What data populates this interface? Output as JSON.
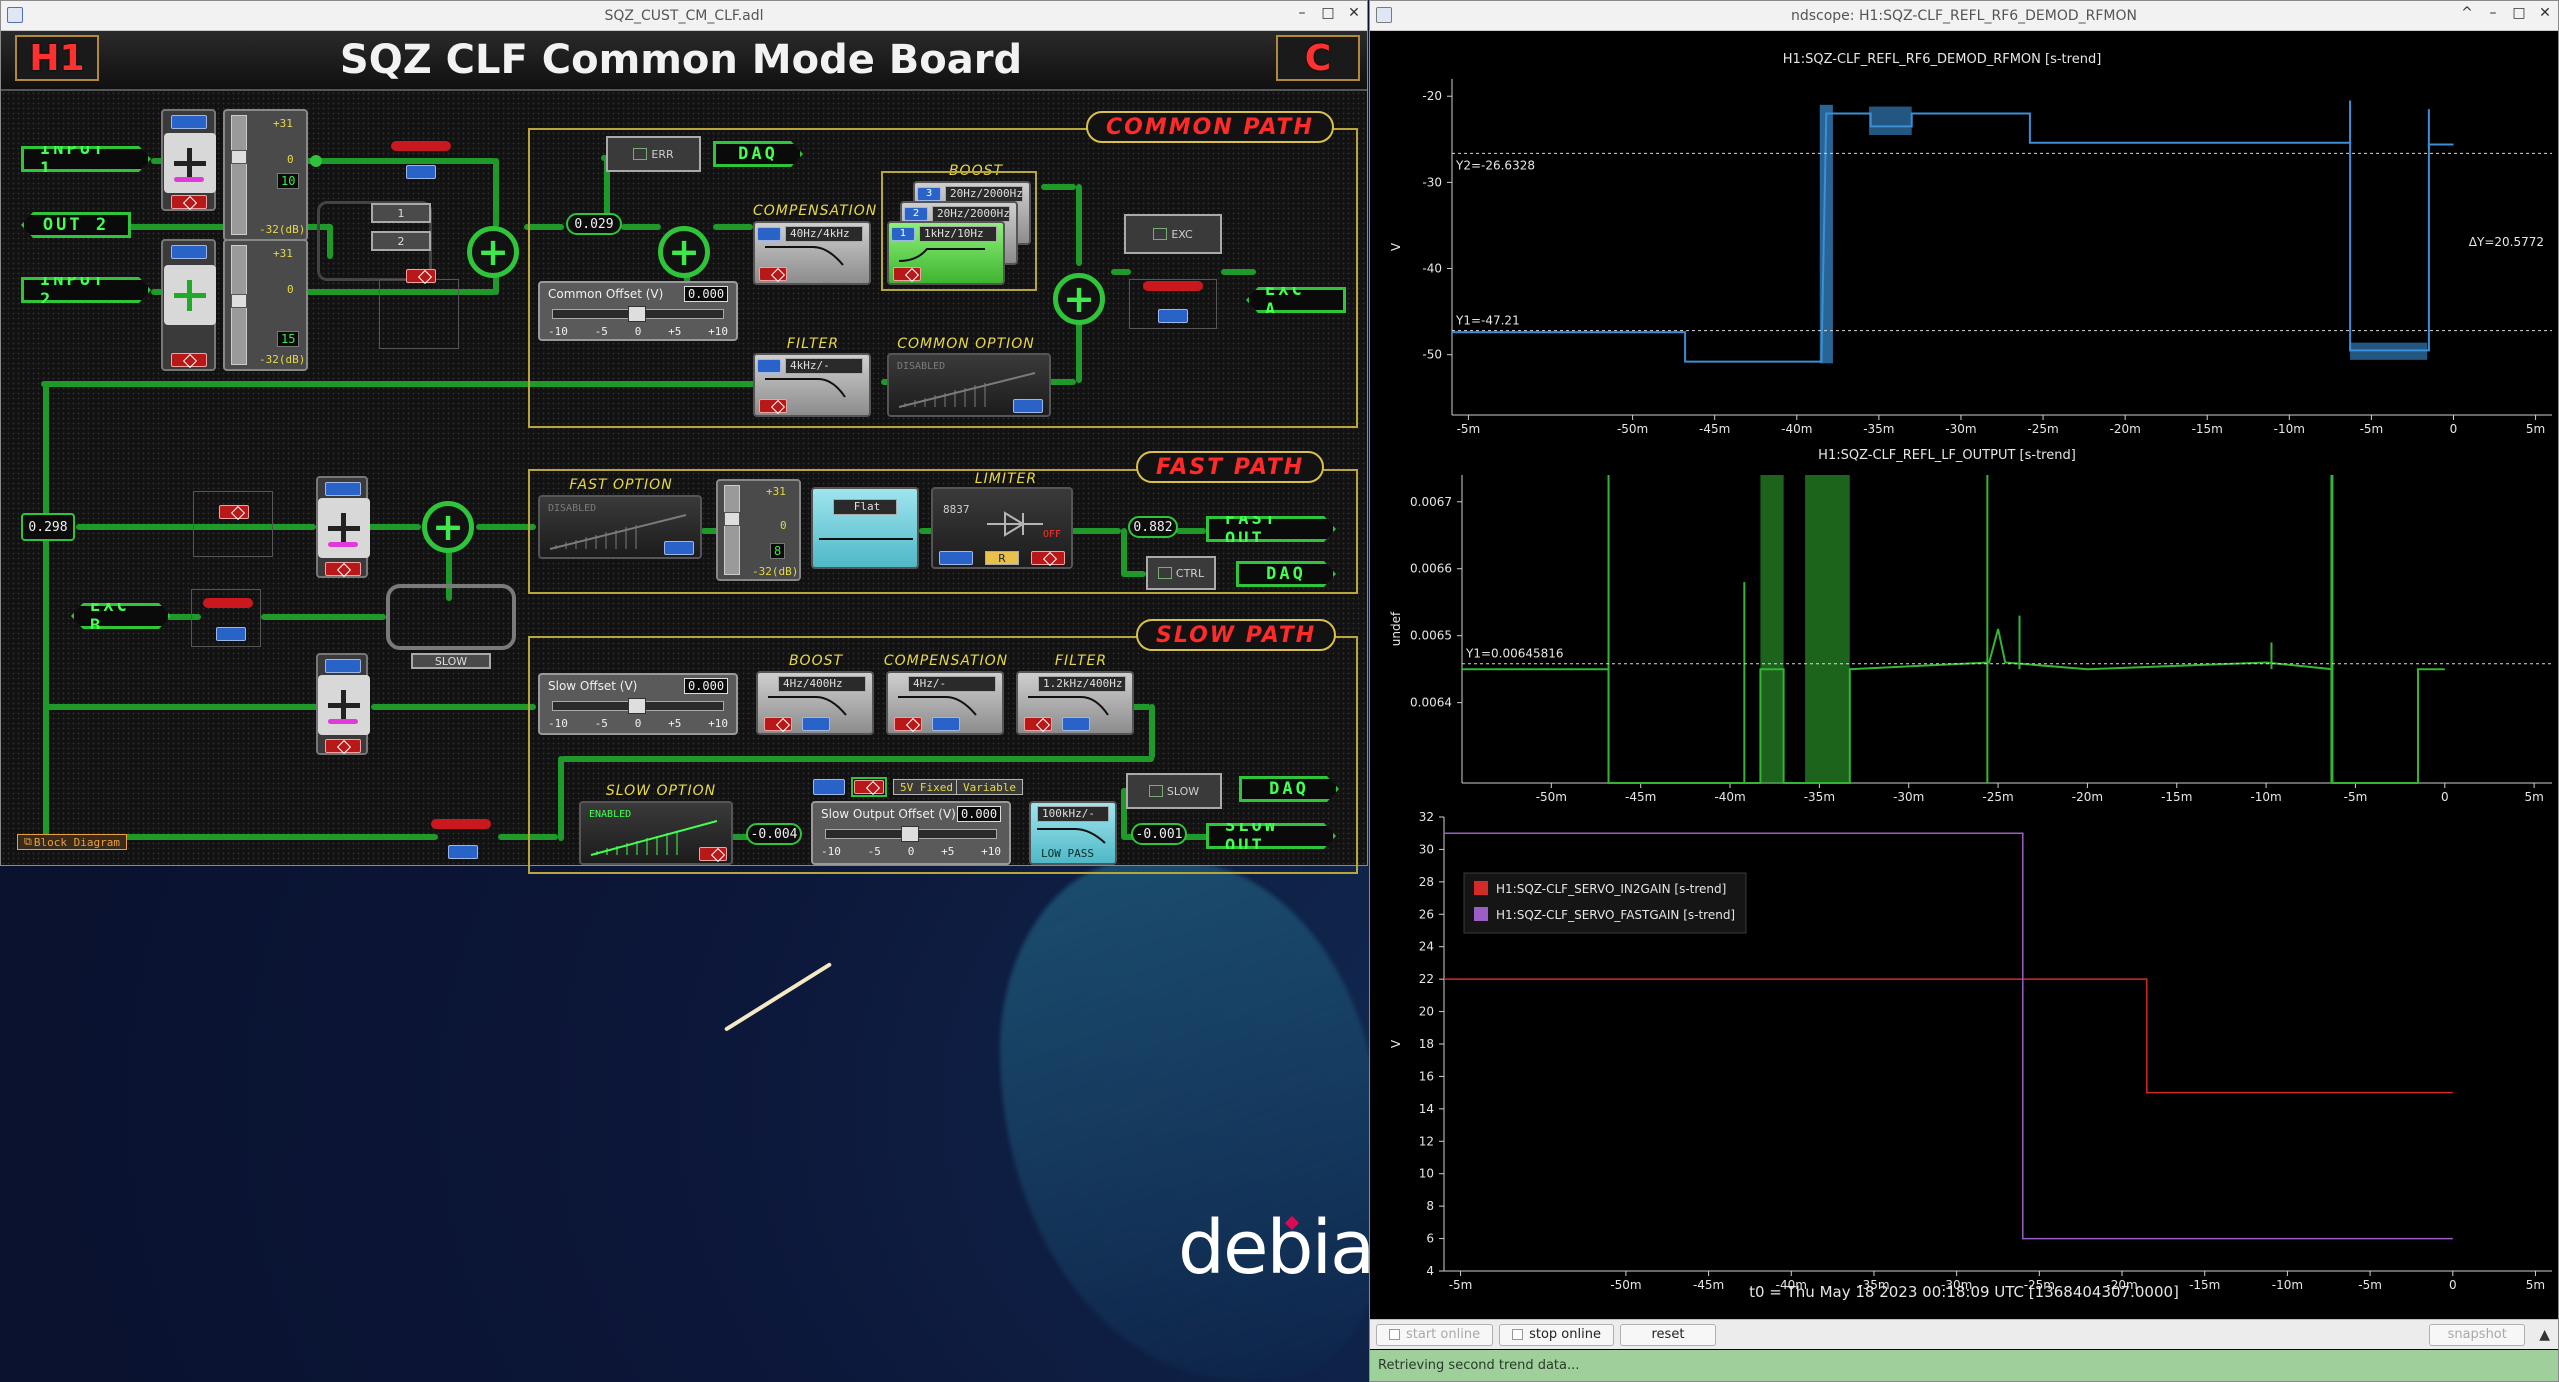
{
  "medm": {
    "window_title": "SQZ_CUST_CM_CLF.adl",
    "window_controls": [
      "–",
      "□",
      "✕"
    ],
    "header": {
      "title": "SQZ CLF Common Mode Board",
      "left_badge": "H1",
      "right_badge": "C"
    },
    "signals": {
      "input1": "INPUT 1",
      "out2": "OUT 2",
      "input2": "INPUT 2",
      "excb": "EXC B",
      "daq_common": "DAQ",
      "exca": "EXC A",
      "fast_out": "FAST OUT",
      "daq_fast": "DAQ",
      "daq_slow": "DAQ",
      "slow_out": "SLOW OUT"
    },
    "sections": {
      "common": "COMMON PATH",
      "fast": "FAST PATH",
      "slow": "SLOW PATH"
    },
    "input1_slider": {
      "top": "+31",
      "mid": "0",
      "bottom": "-32(dB)",
      "value": "10"
    },
    "input2_slider": {
      "top": "+31",
      "mid": "0",
      "bottom": "-32(dB)",
      "value": "15"
    },
    "fast_slider": {
      "top": "+31",
      "mid": "0",
      "bottom": "-32(dB)",
      "value": "8"
    },
    "switch_labels": {
      "one": "1",
      "two": "2"
    },
    "readouts": {
      "common_offset_in": "0.029",
      "split": "0.298",
      "fast_out": "0.882",
      "slow_pre": "-0.004",
      "slow_out": "-0.001"
    },
    "common": {
      "err_label": "ERR",
      "exc_label": "EXC",
      "offset_title": "Common Offset (V)",
      "offset_value": "0.000",
      "ticks": [
        "-10",
        "-5",
        "0",
        "+5",
        "+10"
      ],
      "compensation_label": "COMPENSATION",
      "compensation_readout": "40Hz/4kHz",
      "boost_label": "BOOST",
      "boost_readouts": [
        "20Hz/2000Hz",
        "20Hz/2000Hz",
        "1kHz/10Hz"
      ],
      "boost_stage_numbers": [
        "3",
        "2",
        "1"
      ],
      "filter_label": "FILTER",
      "filter_readout": "4kHz/-",
      "option_label": "COMMON  OPTION",
      "option_state": "DISABLED"
    },
    "fast": {
      "option_label": "FAST  OPTION",
      "option_state": "DISABLED",
      "flat_label": "Flat",
      "limiter_label": "LIMITER",
      "limiter_value": "8837",
      "limiter_off": "OFF",
      "limiter_r": "R",
      "ctrl_label": "CTRL"
    },
    "slow": {
      "slow_label": "SLOW",
      "offset_title": "Slow Offset (V)",
      "offset_value": "0.000",
      "ticks": [
        "-10",
        "-5",
        "0",
        "+5",
        "+10"
      ],
      "boost_label": "BOOST",
      "boost_readout": "4Hz/400Hz",
      "compensation_label": "COMPENSATION",
      "compensation_readout": "4Hz/-",
      "filter_label": "FILTER",
      "filter_readout": "1.2kHz/400Hz",
      "option_label": "SLOW  OPTION",
      "option_state": "ENABLED",
      "fixed_label": "5V Fixed",
      "variable_label": "Variable",
      "output_offset_title": "Slow Output Offset (V)",
      "output_offset_value": "0.000",
      "lowpass_readout": "100kHz/-",
      "lowpass_label": "LOW PASS",
      "slow_ctrl_label": "SLOW"
    },
    "block_diagram_link": "Block Diagram"
  },
  "ndscope": {
    "window_title": "ndscope: H1:SQZ-CLF_REFL_RF6_DEMOD_RFMON",
    "window_controls": [
      "^",
      "–",
      "□",
      "✕"
    ],
    "x_ticks": [
      "-5m",
      "-50m",
      "-45m",
      "-40m",
      "-35m",
      "-30m",
      "-25m",
      "-20m",
      "-15m",
      "-10m",
      "-5m",
      "0",
      "5m"
    ],
    "t0_label": "t0 = Thu May 18 2023 00:18:09 UTC [1368404307.0000]",
    "buttons": {
      "start": "start online",
      "stop": "stop online",
      "reset": "reset",
      "snapshot": "snapshot"
    },
    "status": "Retrieving second trend data...",
    "colors": {
      "rfmon": "#3a8fd6",
      "lf_output": "#33b633",
      "in2gain": "#d42a2a",
      "fastgain": "#9a5ec6"
    }
  },
  "chart_data": [
    {
      "type": "line",
      "title": "H1:SQZ-CLF_REFL_RF6_DEMOD_RFMON [s-trend]",
      "ylabel": "V",
      "xlim": [
        -61,
        6
      ],
      "ylim": [
        -57,
        -18
      ],
      "y_ticks": [
        "-20",
        "-30",
        "-40",
        "-50"
      ],
      "cursors": {
        "y1": "Y1=-47.21",
        "y2": "Y2=-26.6328",
        "dy": "ΔY=20.5772"
      },
      "series": [
        {
          "x": [
            -61,
            -46.8,
            -46.8,
            -38.5,
            -38.2,
            -38.0,
            -35.5,
            -35.5,
            -33.0,
            -33.0,
            -25.8,
            -25.8,
            -6.3,
            -6.3,
            -1.5,
            -1.5,
            0
          ],
          "y": [
            -47.4,
            -47.4,
            -50.8,
            -50.8,
            -22.0,
            -22.0,
            -22.0,
            -23.5,
            -23.5,
            -22.0,
            -22.0,
            -25.4,
            -25.4,
            -49.5,
            -49.5,
            -25.6,
            -25.6
          ]
        }
      ]
    },
    {
      "type": "line",
      "title": "H1:SQZ-CLF_REFL_LF_OUTPUT [s-trend]",
      "ylabel": "undef",
      "xlim": [
        -55,
        6
      ],
      "ylim": [
        0.00628,
        0.00674
      ],
      "y_ticks": [
        "0.0067",
        "0.0066",
        "0.0065",
        "0.0064"
      ],
      "cursors": {
        "y1": "Y1=0.00645816"
      },
      "series": [
        {
          "x": [
            -55,
            -46.8,
            -46.8,
            -38.3,
            -38.3,
            -37.0,
            -37.0,
            -33.3,
            -33.3,
            -25.5,
            -25.0,
            -24.6,
            -20,
            -10,
            -6.3,
            -6.3,
            -1.5,
            -1.5,
            0
          ],
          "y": [
            0.00645,
            0.00645,
            0.00628,
            0.00628,
            0.00645,
            0.00645,
            0.00628,
            0.00628,
            0.00645,
            0.00646,
            0.00651,
            0.00646,
            0.00645,
            0.00646,
            0.00645,
            0.00628,
            0.00628,
            0.00645,
            0.00645
          ]
        }
      ]
    },
    {
      "type": "line",
      "title": "",
      "ylabel": "V",
      "xlim": [
        -61,
        6
      ],
      "ylim": [
        4,
        32
      ],
      "y_ticks": [
        "32",
        "30",
        "28",
        "26",
        "24",
        "22",
        "20",
        "18",
        "16",
        "14",
        "12",
        "10",
        "8",
        "6",
        "4"
      ],
      "legend_position": "top-left",
      "series": [
        {
          "name": "H1:SQZ-CLF_SERVO_IN2GAIN [s-trend]",
          "x": [
            -61,
            -18.5,
            -18.5,
            0
          ],
          "y": [
            22,
            22,
            15,
            15
          ]
        },
        {
          "name": "H1:SQZ-CLF_SERVO_FASTGAIN [s-trend]",
          "x": [
            -61,
            -26,
            -26,
            0
          ],
          "y": [
            31,
            31,
            6,
            6
          ]
        }
      ]
    }
  ]
}
